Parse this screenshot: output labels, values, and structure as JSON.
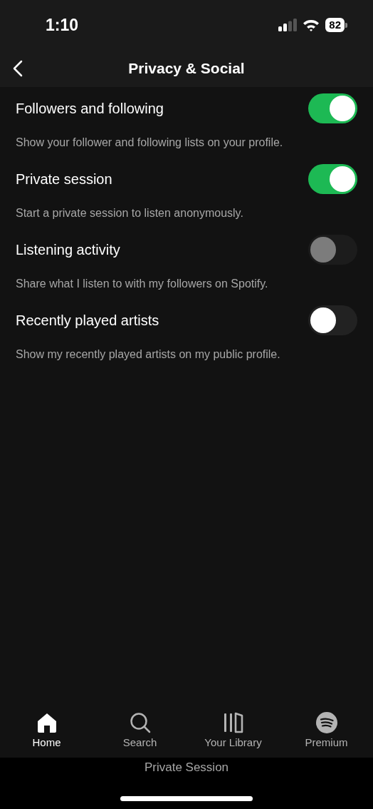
{
  "status_bar": {
    "time": "1:10",
    "battery": "82"
  },
  "header": {
    "title": "Privacy & Social"
  },
  "settings": [
    {
      "label": "Followers and following",
      "description": "Show your follower and following lists on your profile.",
      "on": true,
      "disabled": false
    },
    {
      "label": "Private session",
      "description": "Start a private session to listen anonymously.",
      "on": true,
      "disabled": false
    },
    {
      "label": "Listening activity",
      "description": "Share what I listen to with my followers on Spotify.",
      "on": false,
      "disabled": true
    },
    {
      "label": "Recently played artists",
      "description": "Show my recently played artists on my public profile.",
      "on": false,
      "disabled": false
    }
  ],
  "tabs": [
    {
      "label": "Home",
      "kind": "home",
      "selected": true
    },
    {
      "label": "Search",
      "kind": "search",
      "selected": false
    },
    {
      "label": "Your Library",
      "kind": "library",
      "selected": false
    },
    {
      "label": "Premium",
      "kind": "premium",
      "selected": false
    }
  ],
  "session_banner": "Private Session"
}
